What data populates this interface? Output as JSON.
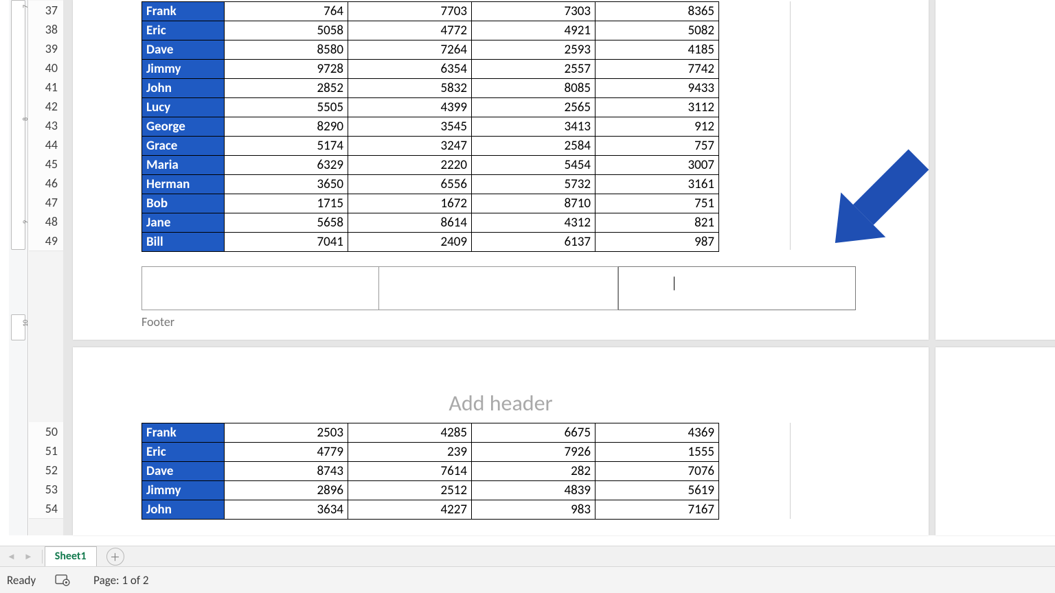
{
  "app": {
    "sheet_tab": "Sheet1"
  },
  "status": {
    "ready": "Ready",
    "page": "Page: 1 of 2"
  },
  "ruler": {
    "marks_top": [
      "7",
      "8",
      "9"
    ],
    "marks_bottom": "10"
  },
  "rows_top_start": 37,
  "rows_bottom_start": 50,
  "table_top": [
    {
      "name": "Frank",
      "a": 764,
      "b": 7703,
      "c": 7303,
      "d": 8365
    },
    {
      "name": "Eric",
      "a": 5058,
      "b": 4772,
      "c": 4921,
      "d": 5082
    },
    {
      "name": "Dave",
      "a": 8580,
      "b": 7264,
      "c": 2593,
      "d": 4185
    },
    {
      "name": "Jimmy",
      "a": 9728,
      "b": 6354,
      "c": 2557,
      "d": 7742
    },
    {
      "name": "John",
      "a": 2852,
      "b": 5832,
      "c": 8085,
      "d": 9433
    },
    {
      "name": "Lucy",
      "a": 5505,
      "b": 4399,
      "c": 2565,
      "d": 3112
    },
    {
      "name": "George",
      "a": 8290,
      "b": 3545,
      "c": 3413,
      "d": 912
    },
    {
      "name": "Grace",
      "a": 5174,
      "b": 3247,
      "c": 2584,
      "d": 757
    },
    {
      "name": "Maria",
      "a": 6329,
      "b": 2220,
      "c": 5454,
      "d": 3007
    },
    {
      "name": "Herman",
      "a": 3650,
      "b": 6556,
      "c": 5732,
      "d": 3161
    },
    {
      "name": "Bob",
      "a": 1715,
      "b": 1672,
      "c": 8710,
      "d": 751
    },
    {
      "name": "Jane",
      "a": 5658,
      "b": 8614,
      "c": 4312,
      "d": 821
    },
    {
      "name": "Bill",
      "a": 7041,
      "b": 2409,
      "c": 6137,
      "d": 987
    }
  ],
  "table_bottom": [
    {
      "name": "Frank",
      "a": 2503,
      "b": 4285,
      "c": 6675,
      "d": 4369
    },
    {
      "name": "Eric",
      "a": 4779,
      "b": 239,
      "c": 7926,
      "d": 1555
    },
    {
      "name": "Dave",
      "a": 8743,
      "b": 7614,
      "c": 282,
      "d": 7076
    },
    {
      "name": "Jimmy",
      "a": 2896,
      "b": 2512,
      "c": 4839,
      "d": 5619
    },
    {
      "name": "John",
      "a": 3634,
      "b": 4227,
      "c": 983,
      "d": 7167
    }
  ],
  "footer": {
    "label": "Footer",
    "left": "",
    "center": "",
    "right": ""
  },
  "header": {
    "placeholder": "Add header"
  }
}
